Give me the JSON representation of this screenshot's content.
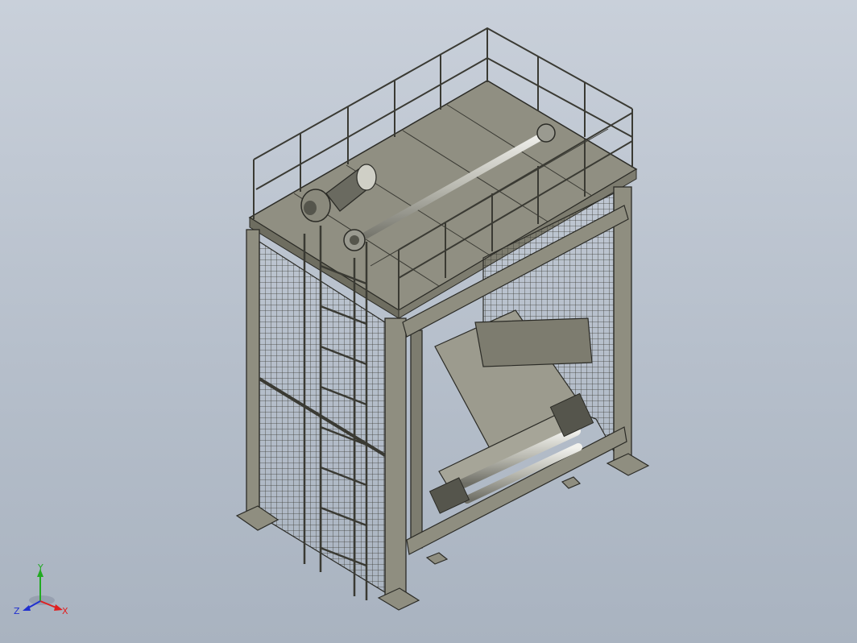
{
  "viewport": {
    "background_top": "#c9d0da",
    "background_bottom": "#a9b3c0",
    "model_fill": "#8f8e80",
    "model_dark": "#6e6d60",
    "model_light": "#b5b4a6",
    "edge_color": "#2b2b26"
  },
  "triad": {
    "x_label": "X",
    "y_label": "Y",
    "z_label": "Z",
    "x_color": "#e02020",
    "y_color": "#22aa22",
    "z_color": "#2030d0"
  }
}
